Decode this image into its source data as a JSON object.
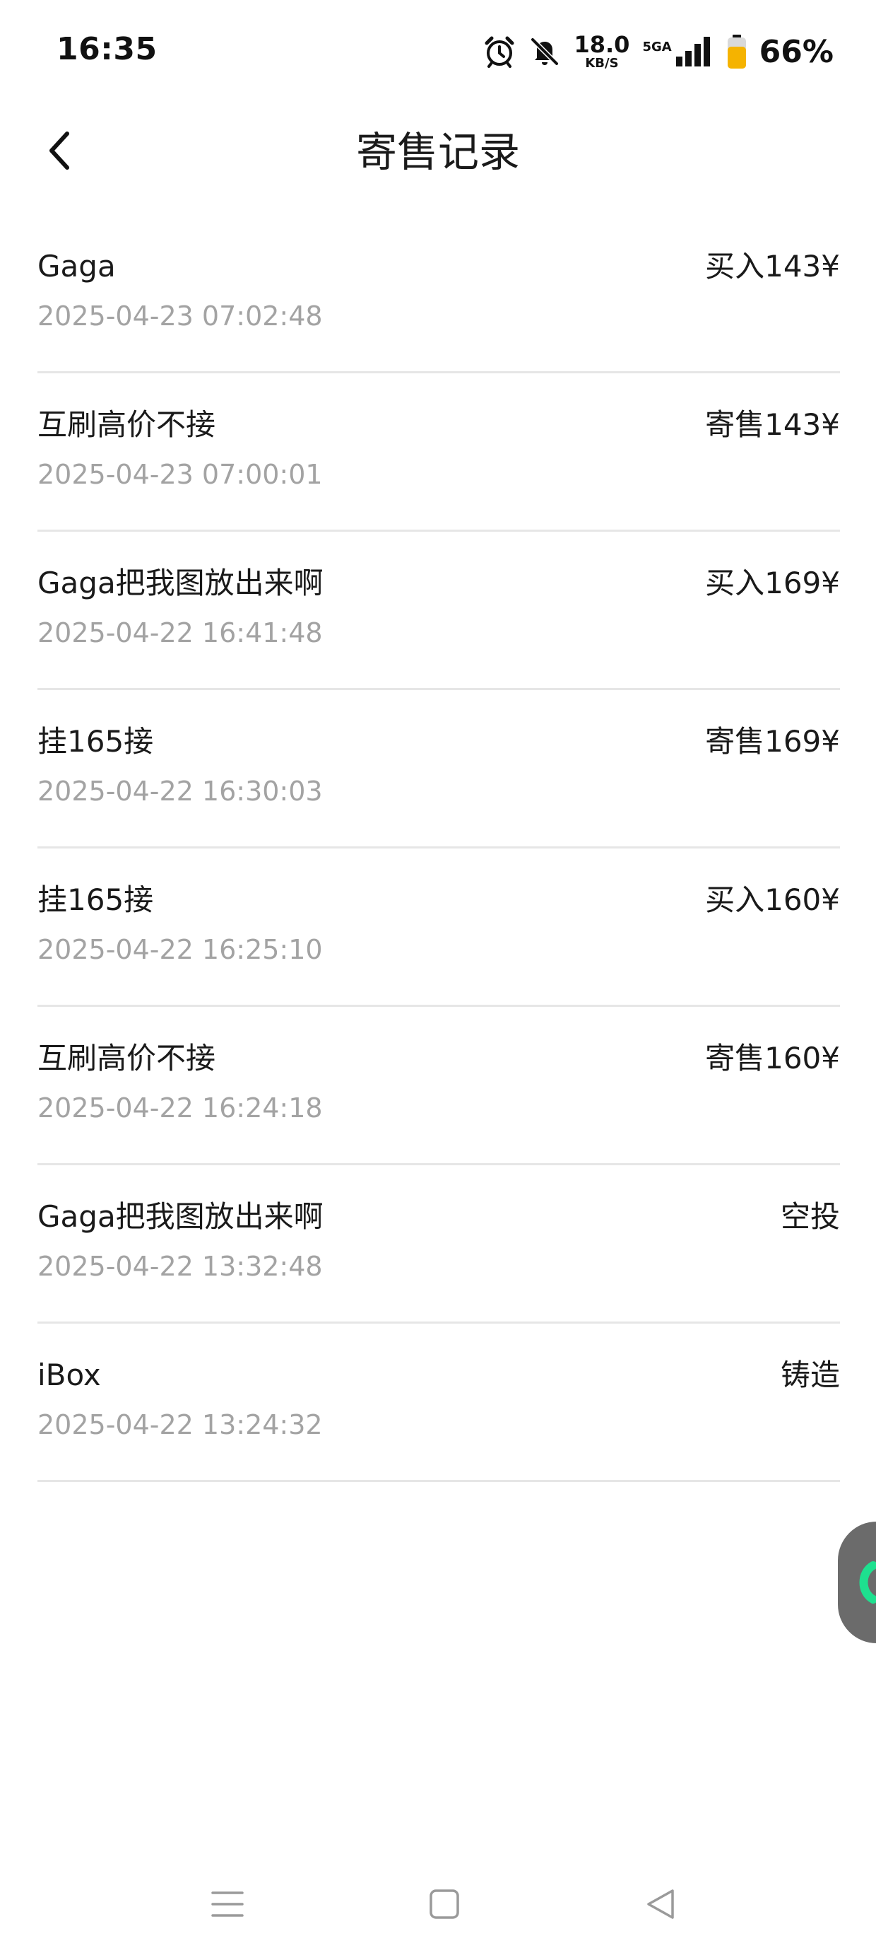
{
  "status_bar": {
    "time": "16:35",
    "net_speed_value": "18.0",
    "net_speed_unit": "KB/S",
    "network_type": "5GA",
    "battery_percent": "66%",
    "icons": [
      "alarm-icon",
      "mute-bell-icon",
      "signal-icon",
      "battery-icon"
    ],
    "battery_color": "#f5b300"
  },
  "header": {
    "title": "寄售记录",
    "back_icon": "chevron-left-icon"
  },
  "records": [
    {
      "name": "Gaga",
      "time": "2025-04-23 07:02:48",
      "action": "买入143¥"
    },
    {
      "name": "互刷高价不接",
      "time": "2025-04-23 07:00:01",
      "action": "寄售143¥"
    },
    {
      "name": "Gaga把我图放出来啊",
      "time": "2025-04-22 16:41:48",
      "action": "买入169¥"
    },
    {
      "name": "挂165接",
      "time": "2025-04-22 16:30:03",
      "action": "寄售169¥"
    },
    {
      "name": "挂165接",
      "time": "2025-04-22 16:25:10",
      "action": "买入160¥"
    },
    {
      "name": "互刷高价不接",
      "time": "2025-04-22 16:24:18",
      "action": "寄售160¥"
    },
    {
      "name": "Gaga把我图放出来啊",
      "time": "2025-04-22 13:32:48",
      "action": "空投"
    },
    {
      "name": "iBox",
      "time": "2025-04-22 13:24:32",
      "action": "铸造"
    }
  ],
  "floating_bubble": {
    "icon": "assistant-bubble-icon",
    "accent_color": "#1ee08f"
  },
  "nav_bar": {
    "icons": [
      "menu-icon",
      "home-icon",
      "back-triangle-icon"
    ]
  }
}
